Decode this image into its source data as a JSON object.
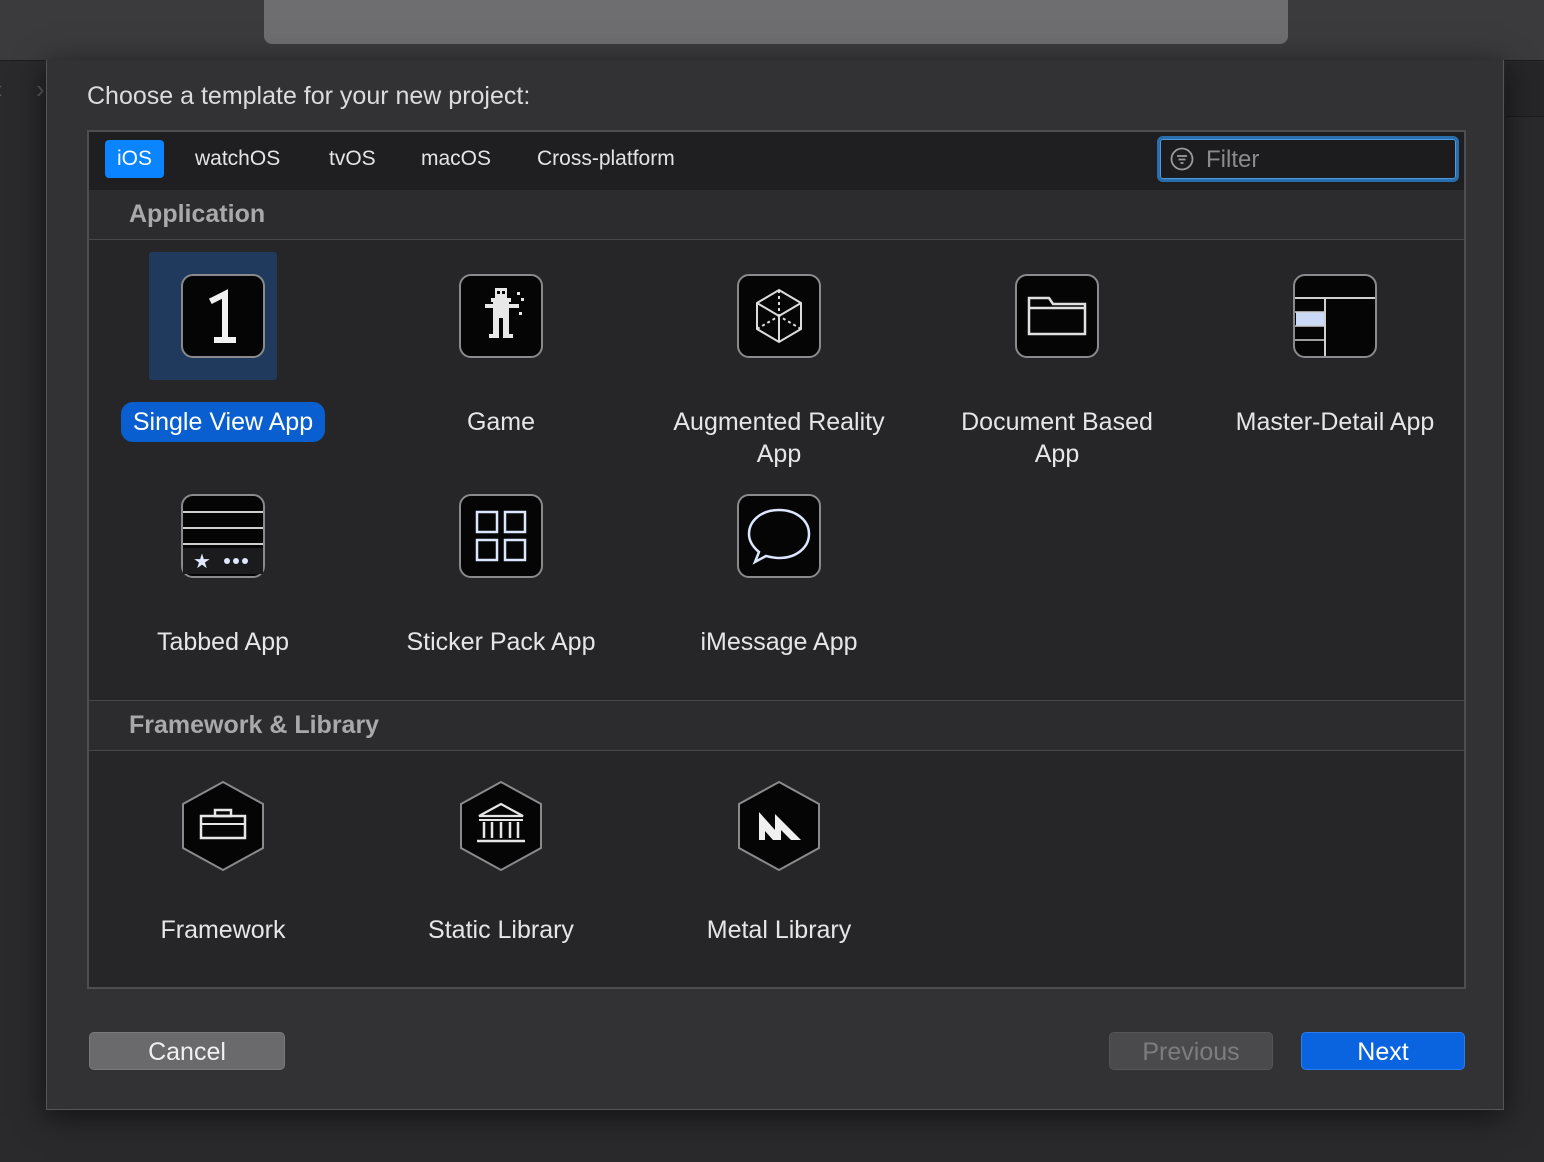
{
  "sheet": {
    "title": "Choose a template for your new project:"
  },
  "platform_tabs": [
    "iOS",
    "watchOS",
    "tvOS",
    "macOS",
    "Cross-platform"
  ],
  "filter": {
    "placeholder": "Filter",
    "icon": "filter-icon"
  },
  "sections": [
    {
      "header": "Application",
      "templates": [
        {
          "label": "Single View App",
          "icon": "single-view-icon",
          "selected": true
        },
        {
          "label": "Game",
          "icon": "game-icon"
        },
        {
          "label": "Augmented Reality App",
          "icon": "ar-cube-icon"
        },
        {
          "label": "Document Based App",
          "icon": "folder-icon"
        },
        {
          "label": "Master-Detail App",
          "icon": "master-detail-icon"
        },
        {
          "label": "Tabbed App",
          "icon": "tabbed-icon"
        },
        {
          "label": "Sticker Pack App",
          "icon": "grid-icon"
        },
        {
          "label": "iMessage App",
          "icon": "message-bubble-icon"
        }
      ]
    },
    {
      "header": "Framework & Library",
      "templates": [
        {
          "label": "Framework",
          "icon": "toolbox-icon"
        },
        {
          "label": "Static Library",
          "icon": "library-building-icon"
        },
        {
          "label": "Metal Library",
          "icon": "metal-icon"
        }
      ]
    }
  ],
  "footer": {
    "cancel": "Cancel",
    "previous": "Previous",
    "next": "Next"
  },
  "colors": {
    "accent": "#0a84ff",
    "selection": "#0a5fd0",
    "background": "#262628"
  }
}
